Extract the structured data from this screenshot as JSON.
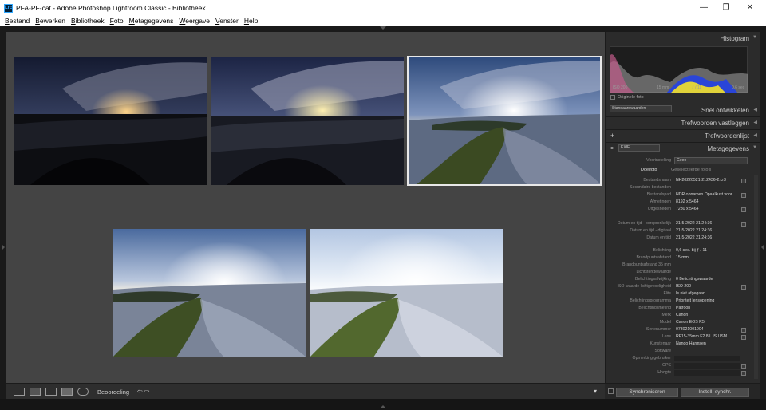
{
  "window": {
    "title": "PFA-PF-cat - Adobe Photoshop Lightroom Classic - Bibliotheek",
    "app_icon": "Lrc",
    "controls": [
      "—",
      "❐",
      "✕"
    ]
  },
  "menu": [
    "Bestand",
    "Bewerken",
    "Bibliotheek",
    "Foto",
    "Metagegevens",
    "Weergave",
    "Venster",
    "Help"
  ],
  "toolbar": {
    "sort_label": "Beoordeling",
    "arrows": "⇦ ⇨",
    "dropdown": "▾"
  },
  "panels": {
    "histogram": {
      "title": "Histogram",
      "stats": [
        "ISO 200",
        "15 mm",
        "ƒ / 11",
        "0,6 sec"
      ],
      "original_label": "Originele foto"
    },
    "quick_develop": {
      "title": "Snel ontwikkelen",
      "preset": "Standaardwaarden"
    },
    "keywording": {
      "title": "Trefwoorden vastleggen"
    },
    "keyword_list": {
      "title": "Trefwoordenlijst",
      "plus": "+"
    },
    "metadata": {
      "title": "Metagegevens",
      "mode": "EXIF",
      "preset_label": "Voorinstelling",
      "preset_value": "Geen",
      "tab_target": "Doelfoto",
      "tab_selected": "Geselecteerde foto's",
      "rows": [
        {
          "label": "Bestandsnaam",
          "value": "NH20220521-212436-2.cr3"
        },
        {
          "label": "Secundaire bestanden",
          "value": ""
        },
        {
          "label": "Bestandspad",
          "value": "HDR opnamen Opaalkust voor..."
        },
        {
          "label": "Afmetingen",
          "value": "8192 x 5464"
        },
        {
          "label": "Uitgesneden",
          "value": "7280 x 5464"
        },
        {
          "label": "",
          "value": ""
        },
        {
          "label": "Datum en tijd - oorspronkelijk",
          "value": "21-5-2022 21:24:36"
        },
        {
          "label": "Datum en tijd - digitaal",
          "value": "21-5-2022 21:24:36"
        },
        {
          "label": "Datum en tijd",
          "value": "21-5-2022 21:24:36"
        },
        {
          "label": "",
          "value": ""
        },
        {
          "label": "Belichting",
          "value": "0,6 sec. bij ƒ / 11"
        },
        {
          "label": "Brandpuntsafstand",
          "value": "15 mm"
        },
        {
          "label": "Brandpuntsafstand 35 mm",
          "value": ""
        },
        {
          "label": "Lichtsterktewaarde",
          "value": ""
        },
        {
          "label": "Belichtingsafwijking",
          "value": "0 Belichtingswaarde"
        },
        {
          "label": "ISO-waarde lichtgevoeligheid",
          "value": "ISO 200"
        },
        {
          "label": "Flits",
          "value": "Is niet afgegaan"
        },
        {
          "label": "Belichtingsprogramma",
          "value": "Prioriteit lensopening"
        },
        {
          "label": "Belichtingsmeting",
          "value": "Patroon"
        },
        {
          "label": "Merk",
          "value": "Canon"
        },
        {
          "label": "Model",
          "value": "Canon EOS R5"
        },
        {
          "label": "Serienummer",
          "value": "073021001904"
        },
        {
          "label": "Lens",
          "value": "RF15-35mm F2.8 L IS USM"
        },
        {
          "label": "Kunstenaar",
          "value": "Nando Harmsen"
        },
        {
          "label": "Software",
          "value": ""
        },
        {
          "label": "Opmerking gebruiker",
          "value": ""
        },
        {
          "label": "GPS",
          "value": ""
        },
        {
          "label": "Hoogte",
          "value": ""
        }
      ]
    }
  },
  "buttons": {
    "sync": "Synchroniseren",
    "sync_settings": "Instell. synchr."
  }
}
